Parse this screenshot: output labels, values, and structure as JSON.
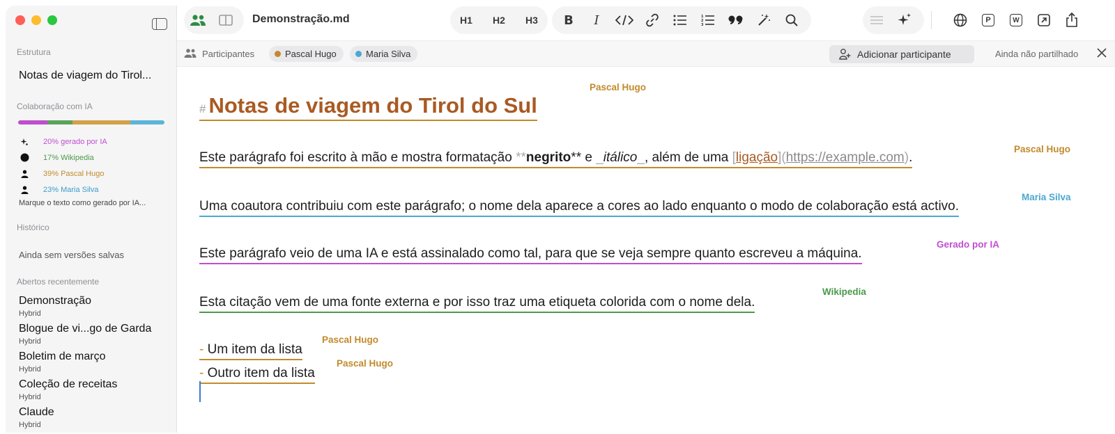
{
  "window": {
    "document_title": "Demonstração.md"
  },
  "colors": {
    "pascal": "#c28a2c",
    "maria": "#4ba8d0",
    "ai": "#c04ed0",
    "wikipedia": "#4a9a4a",
    "heading": "#a95a23"
  },
  "toolbar": {
    "heading_buttons": [
      "H1",
      "H2",
      "H3"
    ],
    "format_icons": [
      "bold-icon",
      "italic-icon",
      "code-icon",
      "link-icon",
      "bullet-list-icon",
      "numbered-list-icon",
      "quote-icon",
      "magic-wand-icon",
      "search-icon"
    ],
    "right_icons": [
      "ai-text-icon",
      "sparkles-icon",
      "globe-icon",
      "p-export-icon",
      "w-export-icon",
      "open-external-icon",
      "share-icon"
    ],
    "bold_label": "B",
    "italic_label": "I",
    "p_label": "P",
    "w_label": "W"
  },
  "sidebar": {
    "structure_heading": "Estrutura",
    "structure_item": "Notas de viagem do Tirol...",
    "ai_heading": "Colaboração com IA",
    "ai_bar": [
      {
        "percent": 20,
        "color": "#c04ed0"
      },
      {
        "percent": 17,
        "color": "#5aa35a"
      },
      {
        "percent": 39,
        "color": "#d2a24a"
      },
      {
        "percent": 23,
        "color": "#5bb5d8"
      }
    ],
    "ai_legend": [
      {
        "label": "20% gerado por IA",
        "color": "#c04ed0",
        "icon": "sparkle-icon"
      },
      {
        "label": "17% Wikipedia",
        "color": "#4a9a4a",
        "icon": "wikipedia-icon"
      },
      {
        "label": "39% Pascal Hugo",
        "color": "#c28a2c",
        "icon": "person-icon"
      },
      {
        "label": "23% Maria Silva",
        "color": "#3c9cc8",
        "icon": "person-icon"
      }
    ],
    "mark_ai_note": "Marque o texto como gerado por IA...",
    "history_heading": "Histórico",
    "history_empty": "Ainda sem versões salvas",
    "recent_heading": "Abertos recentemente",
    "recent": [
      {
        "title": "Demonstração",
        "subtitle": "Hybrid"
      },
      {
        "title": "Blogue de vi...go de Garda",
        "subtitle": "Hybrid"
      },
      {
        "title": "Boletim de março",
        "subtitle": "Hybrid"
      },
      {
        "title": "Coleção de receitas",
        "subtitle": "Hybrid"
      },
      {
        "title": "Claude",
        "subtitle": "Hybrid"
      }
    ]
  },
  "participants": {
    "label": "Participantes",
    "people": [
      {
        "name": "Pascal Hugo",
        "color": "#c28a2c"
      },
      {
        "name": "Maria Silva",
        "color": "#4ba8d0"
      }
    ],
    "add_button": "Adicionar participante",
    "share_state": "Ainda não partilhado"
  },
  "document": {
    "heading": {
      "hash": "#",
      "text": "Notas de viagem do Tirol do Sul",
      "author": "Pascal Hugo"
    },
    "p1": {
      "before": "Este parágrafo foi escrito à mão e mostra formatação ",
      "bold_open": "**",
      "bold": "negrito",
      "bold_close": "**",
      "mid": " e ",
      "italic_open": "_",
      "italic": "itálico",
      "italic_close": "_",
      "after": ", além de uma ",
      "link_open": "[",
      "link_text": "ligação",
      "link_mid": "](",
      "url": "https://example.com",
      "link_close": ")",
      "end": ".",
      "author": "Pascal Hugo"
    },
    "p2": {
      "text": "Uma coautora contribuiu com este parágrafo; o nome dela aparece a cores ao lado enquanto o modo de colaboração está activo.",
      "author": "Maria Silva"
    },
    "p3": {
      "text": "Este parágrafo veio de uma IA e está assinalado como tal, para que se veja sempre quanto escreveu a máquina.",
      "author": "Gerado por IA"
    },
    "p4": {
      "text": "Esta citação vem de uma fonte externa e por isso traz uma etiqueta colorida com o nome dela.",
      "author": "Wikipedia"
    },
    "list": [
      {
        "marker": "-",
        "text": "Um item da lista",
        "author": "Pascal Hugo"
      },
      {
        "marker": "-",
        "text": "Outro item da lista",
        "author": "Pascal Hugo"
      }
    ]
  }
}
